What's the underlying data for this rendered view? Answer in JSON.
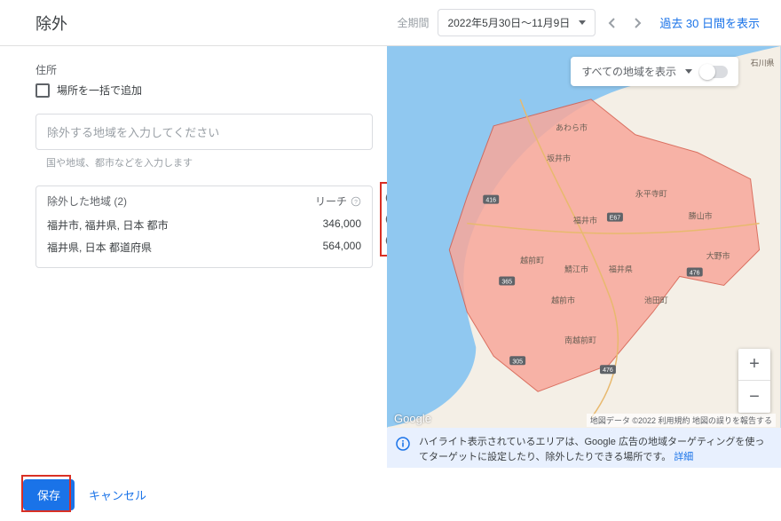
{
  "header": {
    "title": "除外",
    "period_label": "全期間",
    "date_range": "2022年5月30日～11月9日",
    "show_last_days": "過去 30 日間を表示"
  },
  "sidebar": {
    "section_label": "住所",
    "bulk_add_label": "場所を一括で追加",
    "search_placeholder": "除外する地域を入力してください",
    "search_hint": "国や地域、都市などを入力します"
  },
  "excluded": {
    "header_label": "除外した地域 (2)",
    "reach_label": "リーチ",
    "rows": [
      {
        "name": "福井市, 福井県, 日本 都市",
        "reach": "346,000"
      },
      {
        "name": "福井県, 日本 都道府県",
        "reach": "564,000"
      }
    ]
  },
  "map": {
    "dropdown_label": "すべての地域を表示",
    "attribution": "地図データ ©2022   利用規約   地図の誤りを報告する",
    "logo": "Google",
    "region_label": "福井県",
    "side_label": "石川県",
    "cities": [
      "あわら市",
      "坂井市",
      "永平寺町",
      "勝山市",
      "福井市",
      "越前町",
      "鯖江市",
      "大野市",
      "越前市",
      "池田町",
      "南越前町"
    ],
    "info_text": "ハイライト表示されているエリアは、Google 広告の地域ターゲティングを使ってターゲットに設定したり、除外したりできる場所です。",
    "info_detail": "詳細"
  },
  "footer": {
    "save": "保存",
    "cancel": "キャンセル"
  }
}
